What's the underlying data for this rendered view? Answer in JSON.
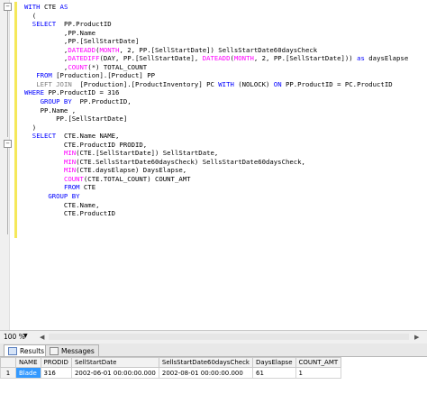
{
  "editor": {
    "lines": [
      [
        {
          "t": "WITH",
          "c": "kw"
        },
        {
          "t": " CTE "
        },
        {
          "t": "AS",
          "c": "kw"
        }
      ],
      [
        {
          "t": "  ("
        }
      ],
      [
        {
          "t": "  "
        },
        {
          "t": "SELECT",
          "c": "kw"
        },
        {
          "t": "  PP.ProductID"
        }
      ],
      [
        {
          "t": "          ,PP.Name"
        }
      ],
      [
        {
          "t": "          ,PP.[SellStartDate]"
        }
      ],
      [
        {
          "t": "          ,"
        },
        {
          "t": "DATEADD",
          "c": "fn"
        },
        {
          "t": "("
        },
        {
          "t": "MONTH",
          "c": "fn"
        },
        {
          "t": ", 2, PP.[SellStartDate]) SellsStartDate60daysCheck"
        }
      ],
      [
        {
          "t": "          ,"
        },
        {
          "t": "DATEDIFF",
          "c": "fn"
        },
        {
          "t": "(DAY, PP.[SellStartDate], "
        },
        {
          "t": "DATEADD",
          "c": "fn"
        },
        {
          "t": "("
        },
        {
          "t": "MONTH",
          "c": "fn"
        },
        {
          "t": ", 2, PP.[SellStartDate])) "
        },
        {
          "t": "as",
          "c": "kw"
        },
        {
          "t": " daysElapse"
        }
      ],
      [
        {
          "t": "          ,"
        },
        {
          "t": "COUNT",
          "c": "fn"
        },
        {
          "t": "(*) TOTAL_COUNT"
        }
      ],
      [
        {
          "t": "   "
        },
        {
          "t": "FROM",
          "c": "kw"
        },
        {
          "t": " [Production].[Product] PP"
        }
      ],
      [
        {
          "t": "   "
        },
        {
          "t": "LEFT JOIN",
          "c": "gy"
        },
        {
          "t": "  [Production].[ProductInventory] PC "
        },
        {
          "t": "WITH",
          "c": "kw"
        },
        {
          "t": " (NOLOCK) "
        },
        {
          "t": "ON",
          "c": "kw"
        },
        {
          "t": " PP.ProductID = PC.ProductID"
        }
      ],
      [
        {
          "t": "WHERE",
          "c": "kw"
        },
        {
          "t": " PP.ProductID = 316"
        }
      ],
      [
        {
          "t": "    "
        },
        {
          "t": "GROUP BY",
          "c": "kw"
        },
        {
          "t": "  PP.ProductID,"
        }
      ],
      [
        {
          "t": "    PP.Name ,"
        }
      ],
      [
        {
          "t": "        PP.[SellStartDate]"
        }
      ],
      [
        {
          "t": "  )"
        }
      ],
      [
        {
          "t": "  "
        },
        {
          "t": "SELECT",
          "c": "kw"
        },
        {
          "t": "  CTE.Name NAME,"
        }
      ],
      [
        {
          "t": "          CTE.ProductID PRODID,"
        }
      ],
      [
        {
          "t": "          "
        },
        {
          "t": "MIN",
          "c": "fn"
        },
        {
          "t": "(CTE.[SellStartDate]) SellStartDate,"
        }
      ],
      [
        {
          "t": "          "
        },
        {
          "t": "MIN",
          "c": "fn"
        },
        {
          "t": "(CTE.SellsStartDate60daysCheck) SellsStartDate60daysCheck,"
        }
      ],
      [
        {
          "t": "          "
        },
        {
          "t": "MIN",
          "c": "fn"
        },
        {
          "t": "(CTE.daysElapse) DaysElapse,"
        }
      ],
      [
        {
          "t": "          "
        },
        {
          "t": "COUNT",
          "c": "fn"
        },
        {
          "t": "(CTE.TOTAL_COUNT) COUNT_AMT"
        }
      ],
      [
        {
          "t": "          "
        },
        {
          "t": "FROM",
          "c": "kw"
        },
        {
          "t": " CTE"
        }
      ],
      [
        {
          "t": "      "
        },
        {
          "t": "GROUP BY",
          "c": "kw"
        }
      ],
      [
        {
          "t": "          CTE.Name,"
        }
      ],
      [
        {
          "t": "          CTE.ProductID"
        }
      ]
    ]
  },
  "status": {
    "zoom": "100 %"
  },
  "tabs": {
    "results": "Results",
    "messages": "Messages"
  },
  "grid": {
    "columns": [
      "NAME",
      "PRODID",
      "SellStartDate",
      "SellsStartDate60daysCheck",
      "DaysElapse",
      "COUNT_AMT"
    ],
    "rows": [
      {
        "num": "1",
        "cells": [
          "Blade",
          "316",
          "2002-06-01 00:00:00.000",
          "2002-08-01 00:00:00.000",
          "61",
          "1"
        ]
      }
    ]
  }
}
